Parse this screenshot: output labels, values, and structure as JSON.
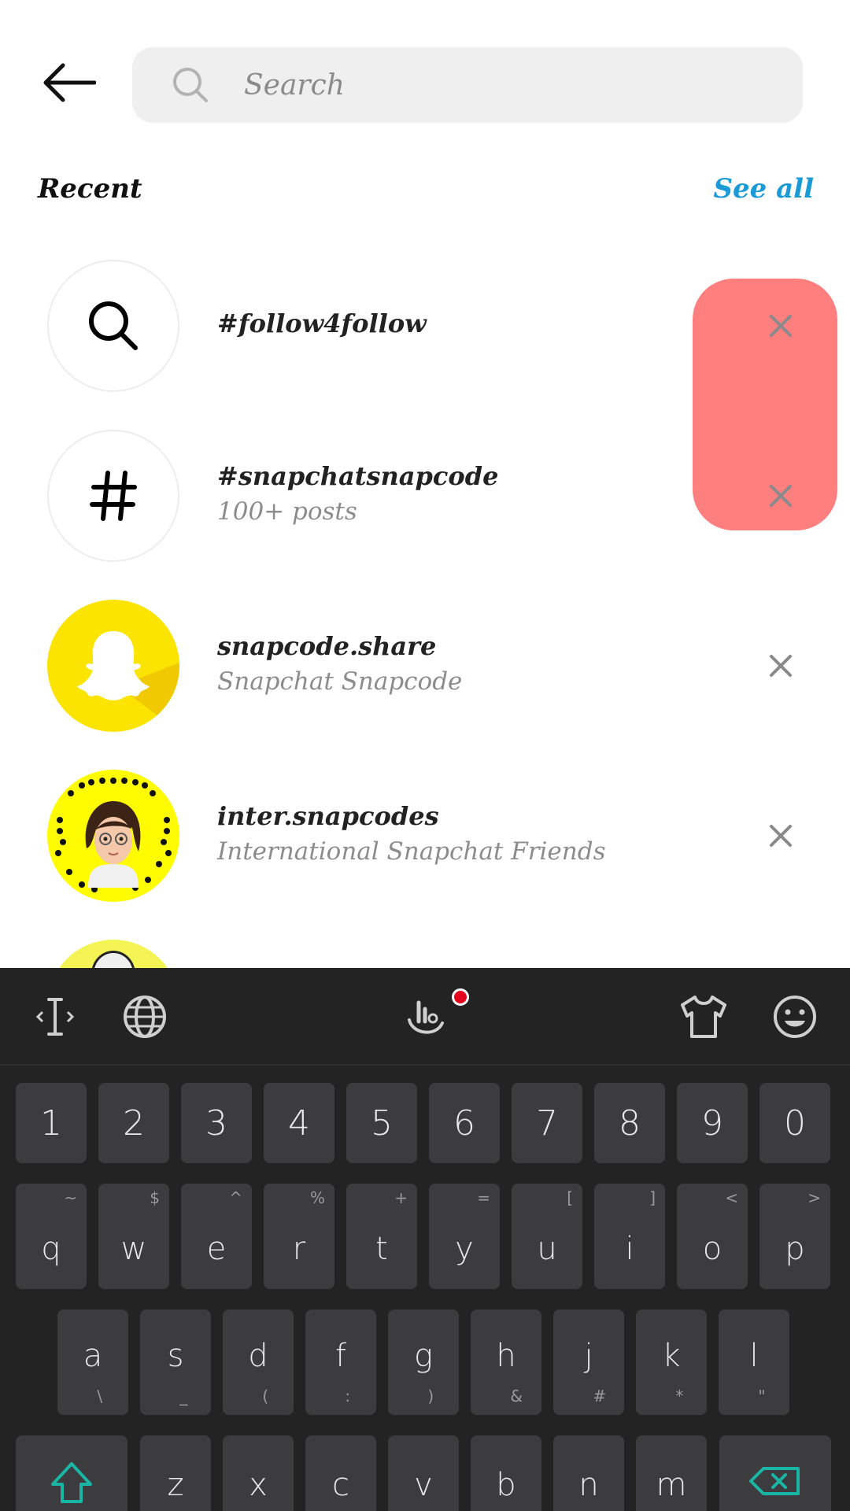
{
  "search": {
    "placeholder": "Search"
  },
  "recent": {
    "title": "Recent",
    "see_all": "See all",
    "items": [
      {
        "type": "search",
        "icon": "search-icon",
        "primary": "#follow4follow",
        "secondary": ""
      },
      {
        "type": "hashtag",
        "icon": "hashtag-icon",
        "primary": "#snapchatsnapcode",
        "secondary": "100+ posts"
      },
      {
        "type": "account",
        "icon": "snapchat-ghost-avatar",
        "primary": "snapcode.share",
        "secondary": "Snapchat Snapcode"
      },
      {
        "type": "account",
        "icon": "bitmoji-snapcode-avatar",
        "primary": "inter.snapcodes",
        "secondary": "International Snapchat Friends"
      }
    ]
  },
  "colors": {
    "accent": "#1a9ad6",
    "highlight": "#ff7e7e",
    "keyboard_bg": "#232323",
    "key_bg": "#3c3c3e",
    "snap_yellow": "#fffc00"
  },
  "keyboard": {
    "toolbar_icons": [
      "cursor-icon",
      "globe-icon",
      "voice-gesture-icon",
      "theme-shirt-icon",
      "emoji-icon"
    ],
    "numbers": [
      "1",
      "2",
      "3",
      "4",
      "5",
      "6",
      "7",
      "8",
      "9",
      "0"
    ],
    "row1": [
      {
        "k": "q",
        "a": "~"
      },
      {
        "k": "w",
        "a": "$"
      },
      {
        "k": "e",
        "a": "^"
      },
      {
        "k": "r",
        "a": "%"
      },
      {
        "k": "t",
        "a": "+"
      },
      {
        "k": "y",
        "a": "="
      },
      {
        "k": "u",
        "a": "["
      },
      {
        "k": "i",
        "a": "]"
      },
      {
        "k": "o",
        "a": "<"
      },
      {
        "k": "p",
        "a": ">"
      }
    ],
    "row2": [
      {
        "k": "a",
        "a": "\\"
      },
      {
        "k": "s",
        "a": "_"
      },
      {
        "k": "d",
        "a": "("
      },
      {
        "k": "f",
        "a": ":"
      },
      {
        "k": "g",
        "a": ")"
      },
      {
        "k": "h",
        "a": "&"
      },
      {
        "k": "j",
        "a": "#"
      },
      {
        "k": "k",
        "a": "*"
      },
      {
        "k": "l",
        "a": "\""
      }
    ],
    "row3": [
      "z",
      "x",
      "c",
      "v",
      "b",
      "n",
      "m"
    ]
  }
}
